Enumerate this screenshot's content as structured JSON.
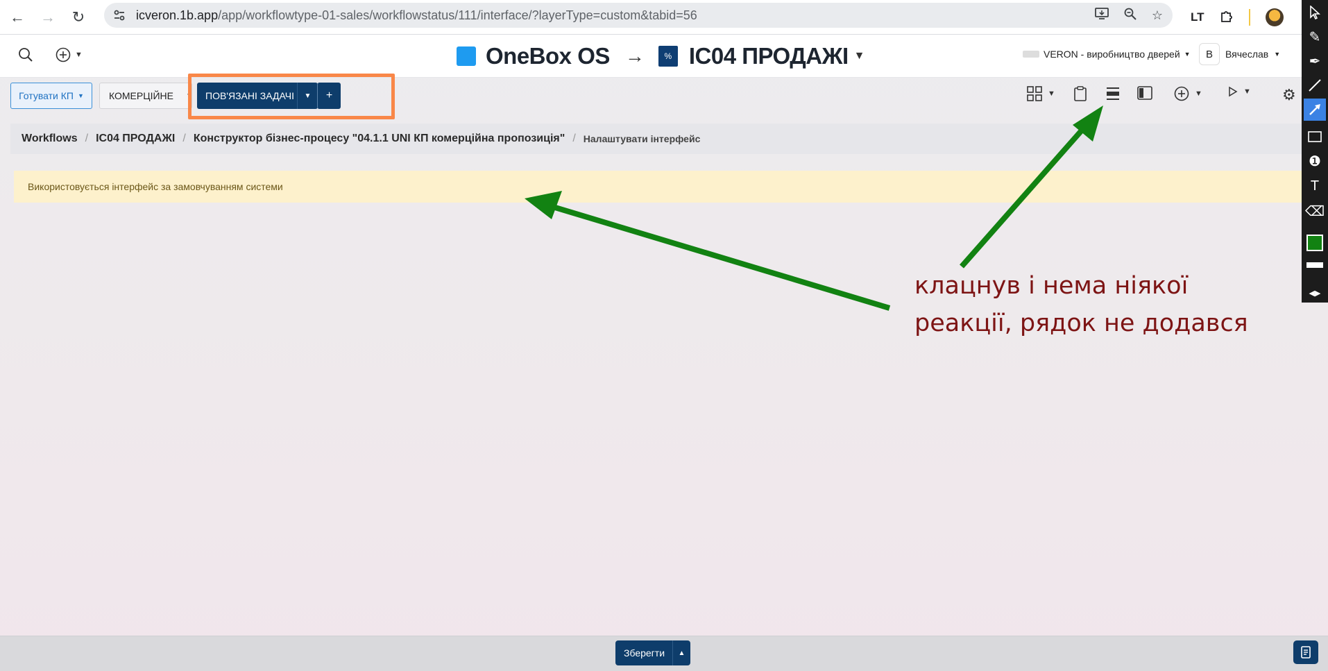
{
  "browser": {
    "url_host": "icveron.1b.app",
    "url_path": "/app/workflowtype-01-sales/workflowstatus/111/interface/?layerType=custom&tabid=56",
    "back_icon": "back-arrow-icon",
    "forward_icon": "forward-arrow-icon",
    "reload_icon": "reload-icon"
  },
  "header": {
    "brand": "OneBox OS",
    "arrow": "→",
    "project": "IC04 ПРОДАЖІ",
    "company": "VERON - виробництво дверей",
    "user_initial": "В",
    "user_name": "Вячеслав"
  },
  "toolbar": {
    "btn_prepare": "Готувати КП",
    "btn_commercial": "КОМЕРЦІЙНЕ",
    "btn_related_tasks": "ПОВ'ЯЗАНІ ЗАДАЧІ",
    "btn_add": "+"
  },
  "breadcrumb": {
    "items": [
      "Workflows",
      "IC04 ПРОДАЖІ",
      "Конструктор бізнес-процесу \"04.1.1 UNI КП комерційна пропозиція\""
    ],
    "current": "Налаштувати інтерфейс",
    "separator": "/"
  },
  "alert": {
    "text": "Використовується інтерфейс за замовчуванням системи"
  },
  "annotation": {
    "line1": "клацнув і нема ніякої",
    "line2": "реакції, рядок не  додався",
    "arrow_color": "#128212",
    "text_color": "#7d1414",
    "box_color": "#f98748"
  },
  "footer": {
    "save": "Зберегти"
  }
}
